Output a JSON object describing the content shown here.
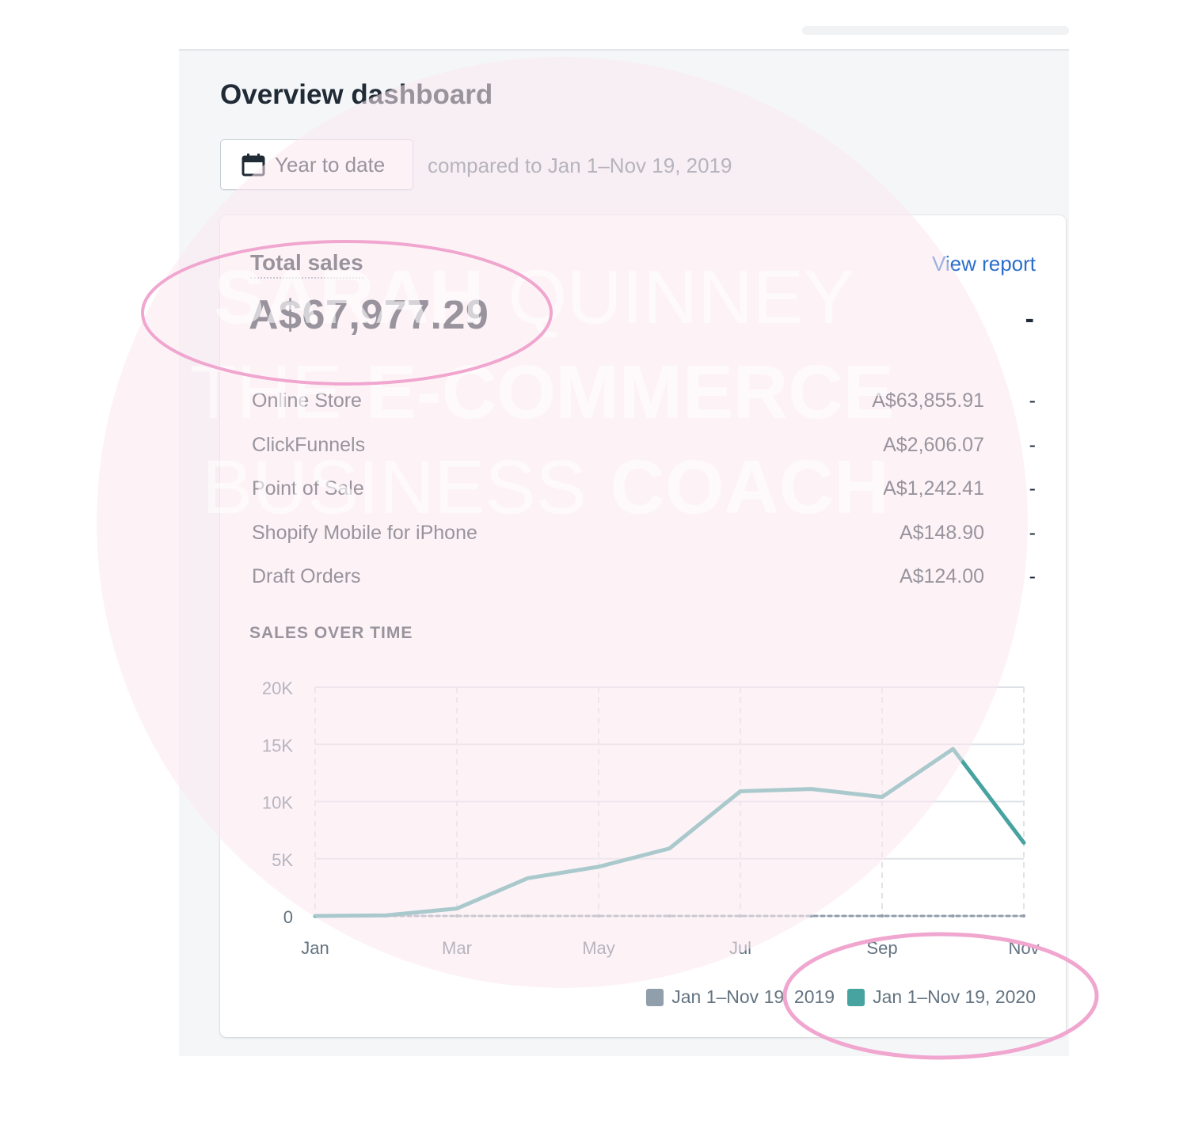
{
  "header": {
    "title": "Overview dashboard",
    "date_button_label": "Year to date",
    "compare_text": "compared to Jan 1–Nov 19, 2019"
  },
  "card": {
    "title": "Total sales",
    "view_report_label": "View report",
    "total_value": "A$67,977.29",
    "total_change": "-",
    "breakdown": [
      {
        "name": "Online Store",
        "value": "A$63,855.91",
        "change": "-"
      },
      {
        "name": "ClickFunnels",
        "value": "A$2,606.07",
        "change": "-"
      },
      {
        "name": "Point of Sale",
        "value": "A$1,242.41",
        "change": "-"
      },
      {
        "name": "Shopify Mobile for iPhone",
        "value": "A$148.90",
        "change": "-"
      },
      {
        "name": "Draft Orders",
        "value": "A$124.00",
        "change": "-"
      }
    ],
    "chart_section_label": "SALES OVER TIME"
  },
  "watermark": {
    "line1_bold": "SARAH",
    "line1_light": "QUINNEY",
    "line2_light": "THE",
    "line2_bold": "E-COMMERCE",
    "line3_light": "BUSINESS",
    "line3_bold": "COACH"
  },
  "colors": {
    "accent_teal": "#47a3a0",
    "previous_gray": "#919eab",
    "link_blue": "#2c6ecb",
    "annotation_pink": "#f0a6cf",
    "watermark_pink": "#fce9f1"
  },
  "icons": {
    "date_button": "calendar-icon"
  },
  "chart_data": {
    "type": "line",
    "title": "SALES OVER TIME",
    "x_tick_labels": [
      "Jan",
      "Mar",
      "May",
      "Jul",
      "Sep",
      "Nov"
    ],
    "x_tick_positions": [
      0,
      2,
      4,
      6,
      8,
      10
    ],
    "y_tick_labels": [
      "0",
      "5K",
      "10K",
      "15K",
      "20K"
    ],
    "y_tick_values": [
      0,
      5000,
      10000,
      15000,
      20000
    ],
    "ylim": [
      0,
      20000
    ],
    "xlim": [
      0,
      10
    ],
    "grid": true,
    "legend_position": "bottom-right",
    "series": [
      {
        "name": "Jan 1–Nov 19, 2019",
        "color": "#919eab",
        "style": "dotted",
        "x": [
          0,
          1,
          2,
          3,
          4,
          5,
          6,
          7,
          8,
          9,
          10
        ],
        "values": [
          0,
          0,
          0,
          0,
          0,
          0,
          0,
          0,
          0,
          0,
          0
        ]
      },
      {
        "name": "Jan 1–Nov 19, 2020",
        "color": "#47a3a0",
        "style": "solid",
        "x": [
          0,
          1,
          2,
          3,
          4,
          5,
          6,
          7,
          8,
          9,
          10
        ],
        "values": [
          0,
          50,
          650,
          3300,
          4300,
          5900,
          10900,
          11100,
          10400,
          14600,
          6400
        ]
      }
    ]
  }
}
